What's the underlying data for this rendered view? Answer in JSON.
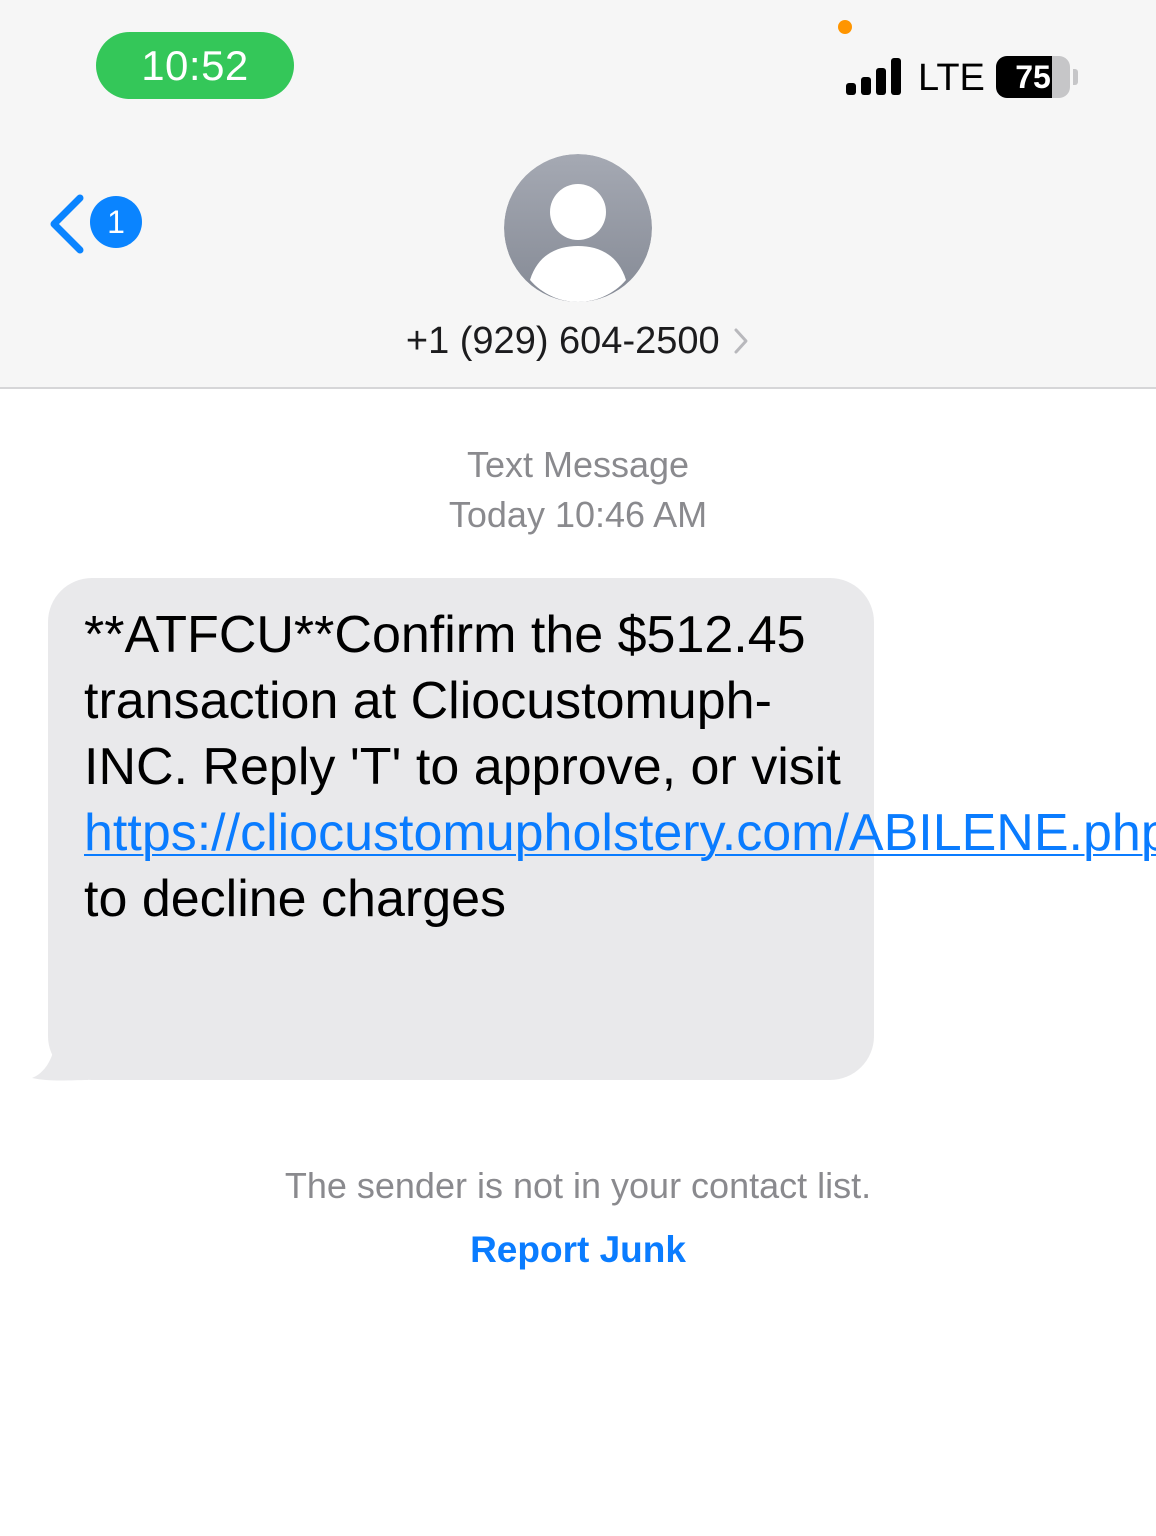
{
  "status_bar": {
    "time": "10:52",
    "network": "LTE",
    "battery": "75",
    "battery_level": 0.75
  },
  "header": {
    "back_badge": "1",
    "contact_number": "+1 (929) 604-2500"
  },
  "conversation": {
    "service": "Text Message",
    "timestamp_day": "Today",
    "timestamp_time": "10:46 AM",
    "message": {
      "text_part_1": "**ATFCU**Confirm the $512.45 transaction at Cliocustomuph-INC. Reply 'T' to approve, or visit ",
      "link": "https://cliocustomupholstery.com/ABILENE.php",
      "text_part_2": " to decline charges"
    }
  },
  "footer": {
    "notice": "The sender is not in your contact list.",
    "report_junk": "Report Junk"
  },
  "colors": {
    "time_pill": "#34c759",
    "accent": "#0a84ff",
    "link": "#0a7cff",
    "bubble": "#e9e9eb",
    "privacy_dot": "#ff9500"
  },
  "icons": [
    "back-chevron-icon",
    "contact-avatar-icon",
    "chevron-right-icon",
    "cellular-signal-icon",
    "battery-icon"
  ]
}
